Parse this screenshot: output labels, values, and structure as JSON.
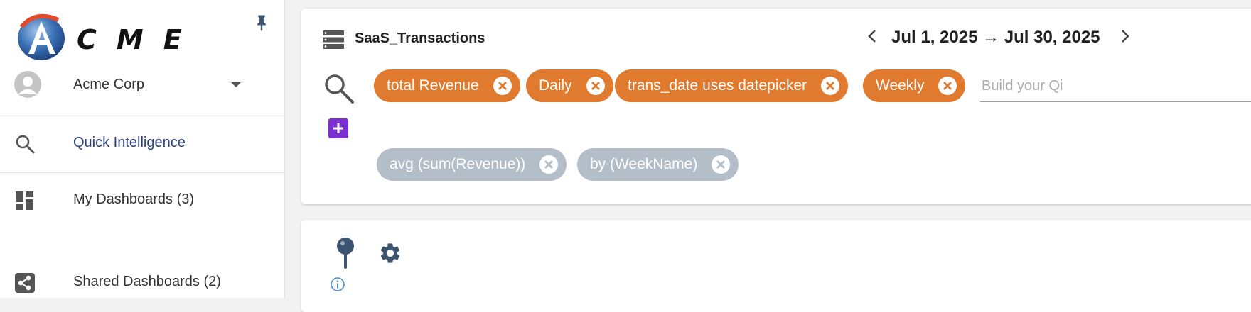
{
  "brand": {
    "logo_text": "CME"
  },
  "sidebar": {
    "org": {
      "name": "Acme Corp"
    },
    "items": [
      {
        "label": "Quick Intelligence",
        "icon": "search-icon",
        "active": true
      },
      {
        "label": "My Dashboards (3)",
        "icon": "dashboard-icon",
        "active": false
      },
      {
        "label": "Shared Dashboards (2)",
        "icon": "share-icon",
        "active": false
      }
    ]
  },
  "query": {
    "dataset": "SaaS_Transactions",
    "date_range": "Jul 1, 2025 → Jul 30, 2025",
    "chips": [
      {
        "label": "total Revenue",
        "color": "#e07a2f"
      },
      {
        "label": "Daily",
        "color": "#e07a2f"
      },
      {
        "label": "trans_date uses datepicker",
        "color": "#e07a2f"
      },
      {
        "label": "Weekly",
        "color": "#e07a2f"
      }
    ],
    "derived_chips": [
      {
        "label": "avg (sum(Revenue))",
        "color": "#b4bec8"
      },
      {
        "label": "by (WeekName)",
        "color": "#b4bec8"
      }
    ],
    "input_placeholder": "Build your Qi",
    "input_value": ""
  },
  "colors": {
    "accent_orange": "#e07a2f",
    "accent_purple": "#7b2fd0",
    "chip_grey": "#b4bec8",
    "nav_active_text": "#2b3d7a",
    "icon_slate": "#3d5470"
  }
}
